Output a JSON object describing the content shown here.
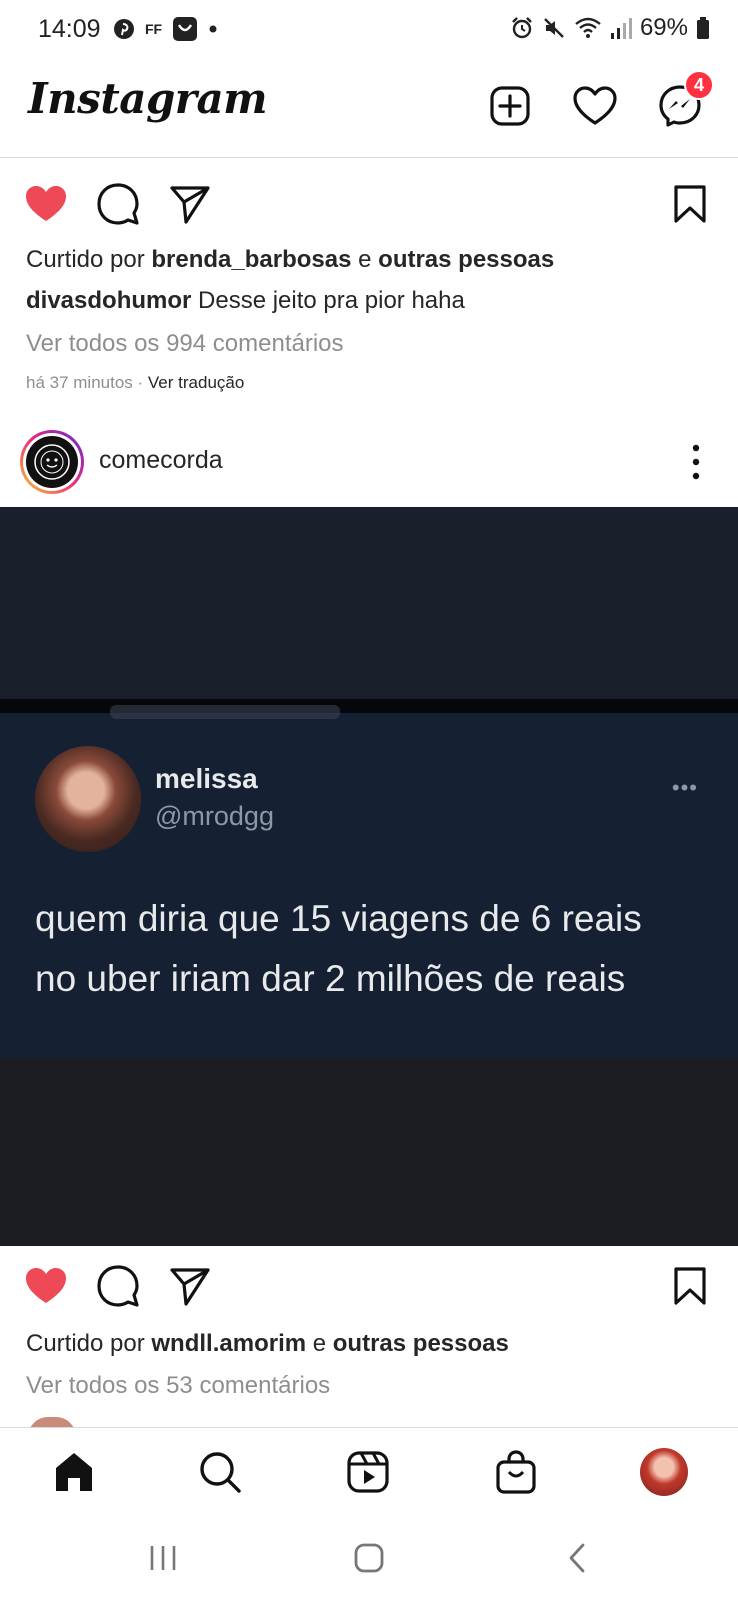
{
  "status_bar": {
    "time": "14:09",
    "left_icons": [
      "pinterest-icon",
      "free-fire-icon",
      "shopee-icon",
      "dot-icon"
    ],
    "ff_text": "FF",
    "right_icons": [
      "alarm-icon",
      "mute-icon",
      "wifi-icon",
      "signal-icon",
      "battery-icon"
    ],
    "battery": "69%"
  },
  "header": {
    "logo": "Instagram",
    "buttons": [
      "new-post-icon",
      "heart-icon",
      "messenger-icon"
    ],
    "messages_badge": "4"
  },
  "post1": {
    "liked_prefix": "Curtido por ",
    "liked_user": "brenda_barbosas",
    "liked_mid": " e ",
    "liked_others": "outras pessoas",
    "caption_user": "divasdohumor",
    "caption_text": " Desse jeito pra pior haha",
    "view_comments": "Ver todos os 994 comentários",
    "time_ago": "há 37 minutos",
    "separator": " · ",
    "translate": "Ver tradução"
  },
  "post2": {
    "username": "comecorda",
    "tweet": {
      "name": "melissa",
      "handle": "@mrodgg",
      "more": "•••",
      "lines": [
        "quem diria que 15 viagens de 6 reais",
        "no uber iriam dar 2 milhões de reais"
      ]
    },
    "liked_prefix": "Curtido por ",
    "liked_user": "wndll.amorim",
    "liked_mid": " e ",
    "liked_others": "outras pessoas",
    "view_comments": "Ver todos os 53 comentários"
  },
  "colors": {
    "like_red": "#ed4956",
    "badge_red": "#ff3040",
    "muted": "#8e8e8e",
    "tweet_bg": "#162033"
  },
  "bottom_nav": [
    "home-icon",
    "search-icon",
    "reels-icon",
    "shop-icon",
    "profile-avatar"
  ],
  "system_nav": [
    "recents-button",
    "home-button",
    "back-button"
  ]
}
